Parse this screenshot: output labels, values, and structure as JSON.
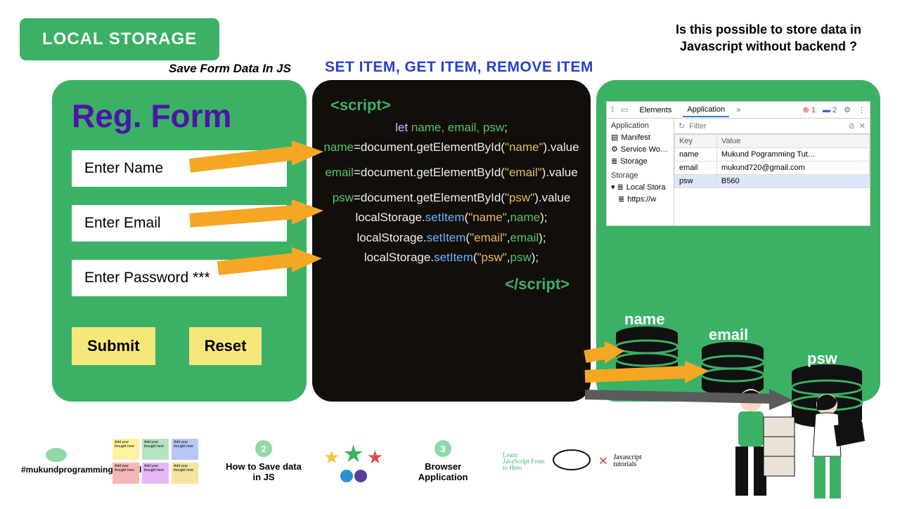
{
  "badge": "LOCAL STORAGE",
  "subtitle": "Save Form Data In JS",
  "methods": "SET ITEM, GET ITEM, REMOVE ITEM",
  "question": "Is this possible to store data in Javascript without backend ?",
  "form": {
    "title": "Reg. Form",
    "fields": [
      "Enter Name",
      "Enter Email",
      "Enter Password ***"
    ],
    "submit": "Submit",
    "reset": "Reset"
  },
  "code": {
    "open": "<script>",
    "close": "</script>",
    "lines": [
      {
        "pre": "let ",
        "ids": "name, email, psw",
        "post": ";"
      },
      {
        "id": "name",
        "mid": "=document.getElementById(",
        "str": "\"name\"",
        "post": ").value"
      },
      {
        "id": "email",
        "mid": "=document.getElementById(",
        "str": "\"email\"",
        "post": ").value"
      },
      {
        "id": "psw",
        "mid": "=document.getElementById(",
        "str": "\"psw\"",
        "post": ").value"
      },
      {
        "obj": "localStorage.",
        "fn": "setItem",
        "args_s": "\"name\"",
        "args_i": "name"
      },
      {
        "obj": "localStorage.",
        "fn": "setItem",
        "args_s": "\"email\"",
        "args_i": "email"
      },
      {
        "obj": "localStorage.",
        "fn": "setItem",
        "args_s": "\"psw\"",
        "args_i": "psw"
      }
    ]
  },
  "devtools": {
    "tabs": [
      "Elements",
      "Application"
    ],
    "errors": "1",
    "msgs": "2",
    "side_head": "Application",
    "side": [
      "Manifest",
      "Service Wo…",
      "Storage"
    ],
    "side2_head": "Storage",
    "side2": [
      "Local Stora",
      "https://w"
    ],
    "filter": "Filter",
    "cols": [
      "Key",
      "Value"
    ],
    "rows": [
      [
        "name",
        "Mukund Pogramming Tut…"
      ],
      [
        "email",
        "mukund720@gmail.com"
      ],
      [
        "psw",
        "B560"
      ]
    ]
  },
  "cylinders": [
    "name",
    "email",
    "psw"
  ],
  "footer": {
    "hashtag": "#mukundprogrammingtutorials",
    "note_text": "Add your thought here",
    "step2_num": "2",
    "step2": "How to Save data in JS",
    "step3_num": "3",
    "step3": "Browser Application",
    "scripty1": "Learn JavaScript From to Hero",
    "scripty2": "Javascript tutorials"
  }
}
